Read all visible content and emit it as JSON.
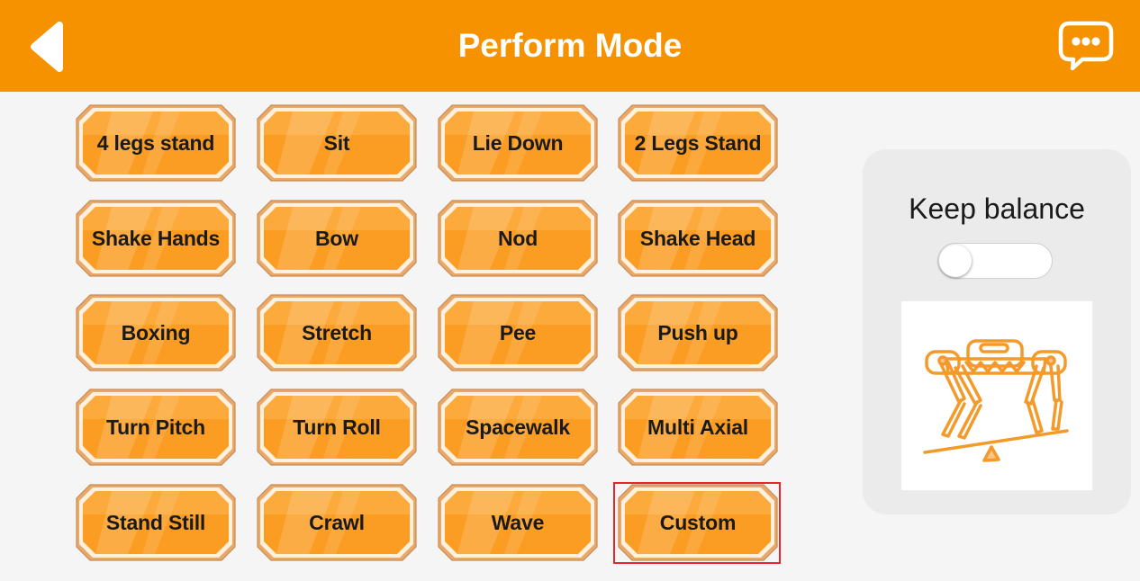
{
  "header": {
    "title": "Perform Mode",
    "back_icon": "back-arrow-icon",
    "chat_icon": "chat-bubble-icon"
  },
  "actions": [
    {
      "label": "4 legs stand"
    },
    {
      "label": "Sit"
    },
    {
      "label": "Lie Down"
    },
    {
      "label": "2 Legs Stand"
    },
    {
      "label": "Shake Hands"
    },
    {
      "label": "Bow"
    },
    {
      "label": "Nod"
    },
    {
      "label": "Shake Head"
    },
    {
      "label": "Boxing"
    },
    {
      "label": "Stretch"
    },
    {
      "label": "Pee"
    },
    {
      "label": "Push up"
    },
    {
      "label": "Turn Pitch"
    },
    {
      "label": "Turn Roll"
    },
    {
      "label": "Spacewalk"
    },
    {
      "label": "Multi Axial"
    },
    {
      "label": "Stand Still"
    },
    {
      "label": "Crawl"
    },
    {
      "label": "Wave"
    },
    {
      "label": "Custom",
      "selected": true
    }
  ],
  "balance": {
    "label": "Keep balance",
    "enabled": false,
    "illustration": "robot-dog-balance-icon"
  },
  "colors": {
    "accent": "#f69200",
    "button_face": "#fba028",
    "selection_border": "#e8262a",
    "panel_bg": "#ebebeb"
  }
}
